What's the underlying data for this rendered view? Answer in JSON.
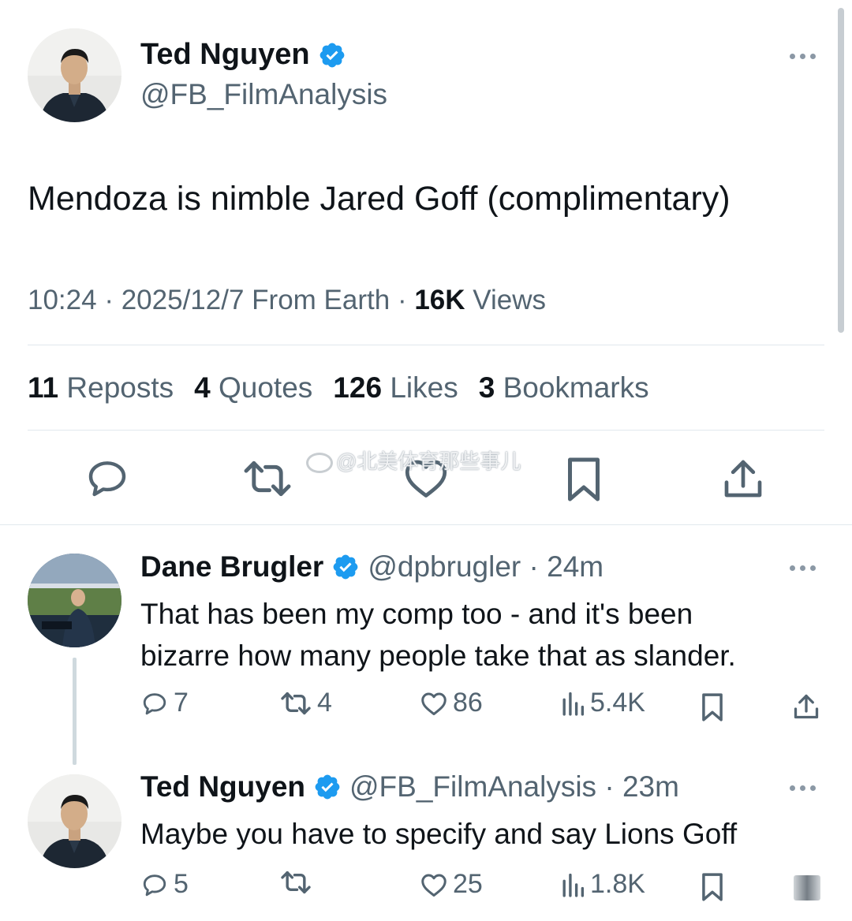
{
  "main_tweet": {
    "author_name": "Ted Nguyen",
    "handle": "@FB_FilmAnalysis",
    "text": "Mendoza is nimble Jared Goff (complimentary)",
    "time": "10:24",
    "date": "2025/12/7",
    "location": "From Earth",
    "views_count": "16K",
    "views_label": "Views",
    "stats": {
      "reposts_count": "11",
      "reposts_label": "Reposts",
      "quotes_count": "4",
      "quotes_label": "Quotes",
      "likes_count": "126",
      "likes_label": "Likes",
      "bookmarks_count": "3",
      "bookmarks_label": "Bookmarks"
    }
  },
  "watermark": "@北美体育那些事儿",
  "replies": [
    {
      "author_name": "Dane Brugler",
      "handle": "@dpbrugler",
      "age": "24m",
      "text_line1": "That has been my comp too - and it's been",
      "text_line2": "bizarre how many people take that as slander.",
      "reply_count": "7",
      "repost_count": "4",
      "like_count": "86",
      "view_count": "5.4K"
    },
    {
      "author_name": "Ted Nguyen",
      "handle": "@FB_FilmAnalysis",
      "age": "23m",
      "text_line1": "Maybe you have to specify and say Lions Goff",
      "reply_count": "5",
      "repost_count": "",
      "like_count": "25",
      "view_count": "1.8K"
    }
  ],
  "colors": {
    "text": "#0f1419",
    "secondary": "#536471",
    "verified": "#1d9bf0",
    "divider": "#e1e8ed"
  },
  "icons": [
    "verified-badge-icon",
    "more-icon",
    "reply-icon",
    "repost-icon",
    "like-icon",
    "bookmark-icon",
    "share-icon",
    "views-icon"
  ]
}
